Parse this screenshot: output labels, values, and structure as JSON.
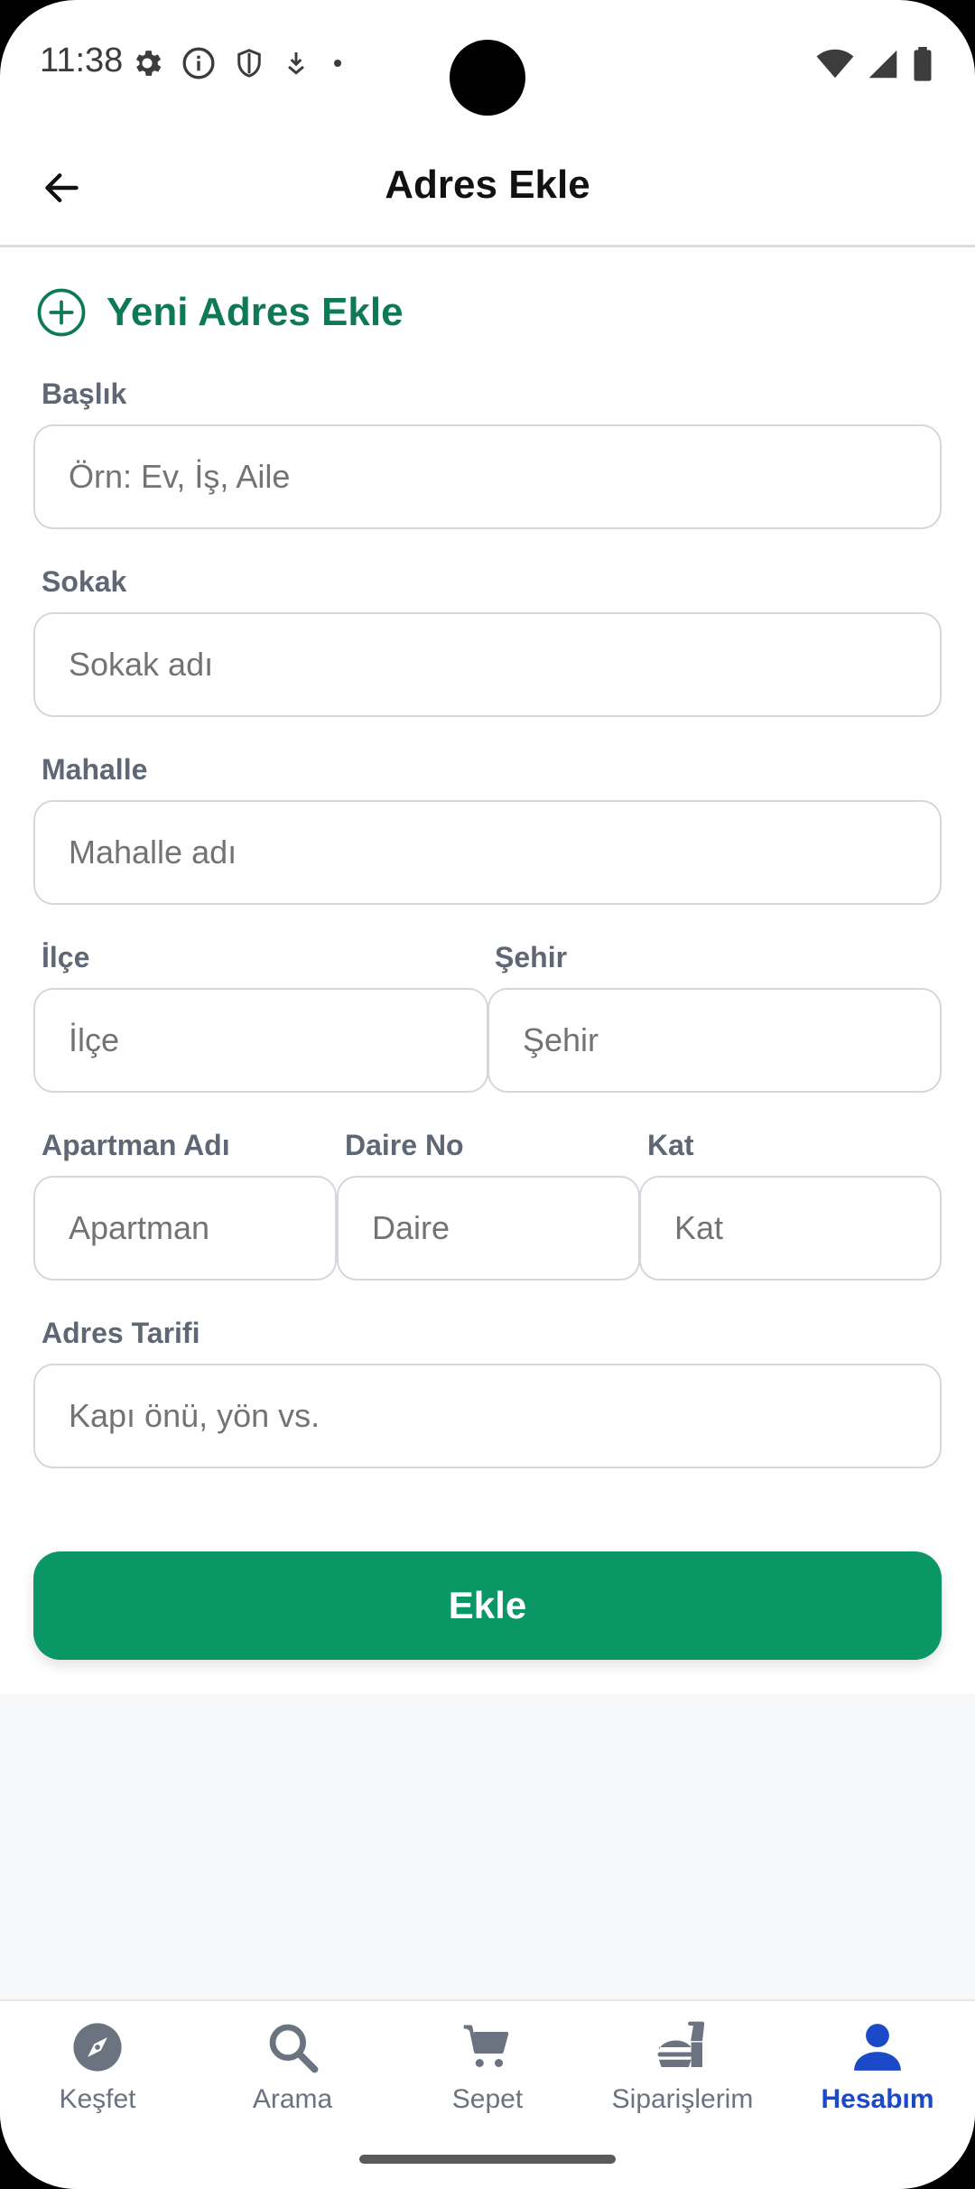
{
  "status_bar": {
    "time": "11:38"
  },
  "app_bar": {
    "title": "Adres Ekle"
  },
  "section": {
    "title": "Yeni Adres Ekle"
  },
  "fields": {
    "baslik": {
      "label": "Başlık",
      "placeholder": "Örn: Ev, İş, Aile",
      "value": ""
    },
    "sokak": {
      "label": "Sokak",
      "placeholder": "Sokak adı",
      "value": ""
    },
    "mahalle": {
      "label": "Mahalle",
      "placeholder": "Mahalle adı",
      "value": ""
    },
    "ilce": {
      "label": "İlçe",
      "placeholder": "İlçe",
      "value": ""
    },
    "sehir": {
      "label": "Şehir",
      "placeholder": "Şehir",
      "value": ""
    },
    "apartman": {
      "label": "Apartman Adı",
      "placeholder": "Apartman",
      "value": ""
    },
    "daire": {
      "label": "Daire No",
      "placeholder": "Daire",
      "value": ""
    },
    "kat": {
      "label": "Kat",
      "placeholder": "Kat",
      "value": ""
    },
    "tarif": {
      "label": "Adres Tarifi",
      "placeholder": "Kapı önü, yön vs.",
      "value": ""
    }
  },
  "submit": {
    "label": "Ekle"
  },
  "colors": {
    "accent_green": "#0b9666",
    "title_green": "#0e7a55",
    "active_blue": "#1b49c8"
  },
  "bottom_nav": {
    "items": [
      {
        "label": "Keşfet",
        "icon": "compass-icon",
        "active": false
      },
      {
        "label": "Arama",
        "icon": "search-icon",
        "active": false
      },
      {
        "label": "Sepet",
        "icon": "cart-icon",
        "active": false
      },
      {
        "label": "Siparişlerim",
        "icon": "food-delivery-icon",
        "active": false
      },
      {
        "label": "Hesabım",
        "icon": "person-icon",
        "active": true
      }
    ]
  }
}
